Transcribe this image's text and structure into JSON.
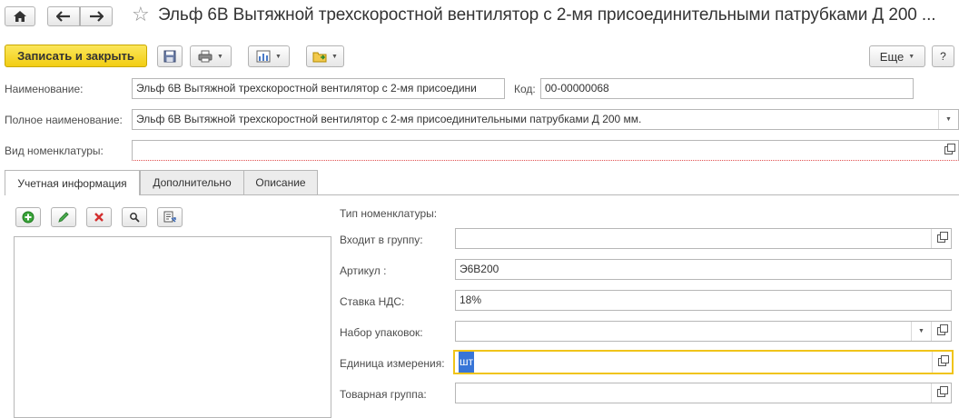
{
  "header": {
    "title": "Эльф 6В Вытяжной трехскоростной вентилятор с 2-мя присоединительными патрубками Д 200 ...",
    "icons": [
      "home-icon",
      "back-arrow-icon",
      "forward-arrow-icon",
      "star-icon"
    ]
  },
  "toolbar": {
    "save_close_label": "Записать и закрыть",
    "more_label": "Еще",
    "help_label": "?",
    "icons": [
      "save-icon",
      "print-icon",
      "report-icon",
      "folder-icon"
    ]
  },
  "form": {
    "name_label": "Наименование:",
    "name_value": "Эльф 6В Вытяжной трехскоростной вентилятор с 2-мя присоедини",
    "code_label": "Код:",
    "code_value": "00-00000068",
    "fullname_label": "Полное наименование:",
    "fullname_value": "Эльф 6В Вытяжной трехскоростной вентилятор с 2-мя присоединительными патрубками Д 200 мм.",
    "kind_label": "Вид номенклатуры:",
    "kind_value": ""
  },
  "tabs": [
    {
      "label": "Учетная информация",
      "active": true
    },
    {
      "label": "Дополнительно",
      "active": false
    },
    {
      "label": "Описание",
      "active": false
    }
  ],
  "list_toolbar_icons": [
    "add-icon",
    "edit-icon",
    "delete-icon",
    "search-icon",
    "settings-icon"
  ],
  "details": {
    "type_label": "Тип номенклатуры:",
    "group_label": "Входит в группу:",
    "group_value": "",
    "article_label": "Артикул :",
    "article_value": "Э6В200",
    "vat_label": "Ставка НДС:",
    "vat_value": "18%",
    "pack_label": "Набор упаковок:",
    "pack_value": "",
    "unit_label": "Единица измерения:",
    "unit_value": "шт",
    "product_group_label": "Товарная группа:",
    "product_group_value": ""
  },
  "colors": {
    "primary_button": "#f2cd13",
    "focus_border": "#f0c419",
    "selection": "#3875d7"
  }
}
